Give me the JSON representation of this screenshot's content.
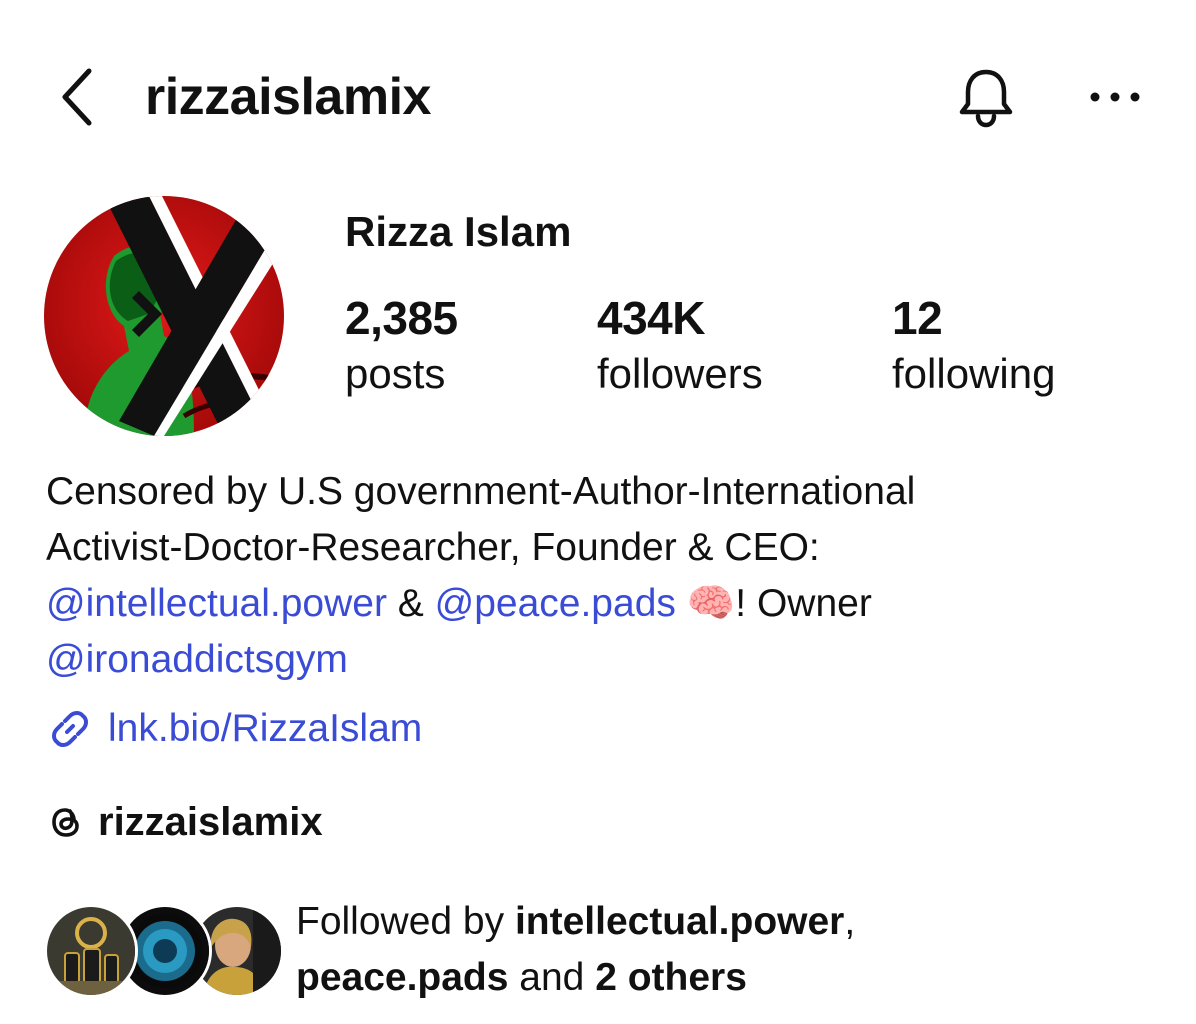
{
  "header": {
    "username": "rizzaislamix",
    "icons": [
      "chevron-left-icon",
      "bell-icon",
      "more-horizontal-icon"
    ]
  },
  "profile": {
    "display_name": "Rizza Islam",
    "stats": [
      {
        "value": "2,385",
        "label": "posts"
      },
      {
        "value": "434K",
        "label": "followers"
      },
      {
        "value": "12",
        "label": "following"
      }
    ]
  },
  "bio": {
    "line1": "Censored by U.S government-Author-International",
    "line2": "Activist-Doctor-Researcher, Founder & CEO:",
    "mention1": "@intellectual.power",
    "connector": " & ",
    "mention2": "@peace.pads",
    "emoji": "🧠",
    "after_emoji": "! Owner",
    "mention3": "@ironaddictsgym"
  },
  "link": {
    "text": "lnk.bio/RizzaIslam",
    "icon": "link-icon"
  },
  "threads": {
    "handle": "rizzaislamix",
    "icon": "threads-icon"
  },
  "followed_by": {
    "prefix": "Followed by ",
    "user1": "intellectual.power",
    "comma": ",",
    "user2": "peace.pads",
    "and": " and ",
    "others": "2 others"
  },
  "colors": {
    "link_blue": "#3a4bd6",
    "text": "#111111",
    "background": "#ffffff"
  }
}
